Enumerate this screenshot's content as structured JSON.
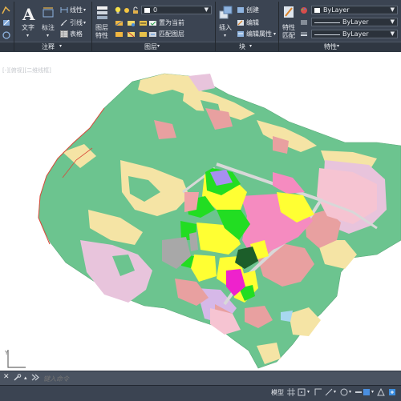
{
  "ribbon": {
    "annotate": {
      "text_label": "文字",
      "dim_label": "标注",
      "linear_label": "线性",
      "leader_label": "引线",
      "table_label": "表格",
      "panel_title": "注释"
    },
    "layers": {
      "layer_props_label": "图层",
      "layer_props_label2": "特性",
      "current_layer": "0",
      "make_current_label": "置为当前",
      "match_layer_label": "匹配图层",
      "panel_title": "图层"
    },
    "block": {
      "insert_label": "插入",
      "create_label": "创建",
      "edit_label": "编辑",
      "edit_attr_label": "编辑属性",
      "panel_title": "块"
    },
    "properties": {
      "match_label": "特性",
      "match_label2": "匹配",
      "color_value": "ByLayer",
      "linetype_value": "ByLayer",
      "lineweight_value": "ByLayer",
      "panel_title": "特性"
    }
  },
  "command": {
    "placeholder": "键入命令"
  },
  "status": {
    "model_tab": "模型"
  },
  "colors": {
    "forest": "#6cc48f",
    "agri": "#f5e4a5",
    "residential": "#ffff33",
    "commercial": "#f58bc0",
    "green_space": "#22dd22",
    "industrial": "#a8a8a8",
    "village": "#e8a0a0",
    "water_protect": "#e8c4dc"
  }
}
